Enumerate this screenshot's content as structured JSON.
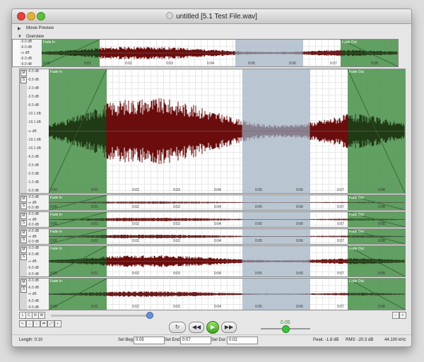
{
  "window": {
    "title": "untitled [5.1 Test File.wav]"
  },
  "sections": {
    "movie_preview": "Movie Preview",
    "overview": "Overview"
  },
  "colors": {
    "fade": "#5a9a5a",
    "wave": "#6b0d0d",
    "wave_sel": "#8a7f8f",
    "selection": "#b9c6d2",
    "wave_fade": "#203a15"
  },
  "fade_labels": {
    "in": "Fade In",
    "out": "Fade Out"
  },
  "time_ticks": [
    "0:00",
    "0:01",
    "0:02",
    "0:03",
    "0:04",
    "0:05",
    "0:06",
    "0:07",
    "0:08"
  ],
  "overview_db": [
    "-0.0 dB",
    "-6.0 dB",
    "-∞ dB",
    "-6.0 dB",
    "-0.0 dB"
  ],
  "main_db": [
    "-0.0 dB",
    "-0.9 dB",
    "-2.0 dB",
    "-3.5 dB",
    "-6.0 dB",
    "-10.1 dB",
    "-19.1 dB",
    "-∞ dB",
    "-19.1 dB",
    "-10.1 dB",
    "-6.0 dB",
    "-3.5 dB",
    "-2.0 dB",
    "-1.2 dB",
    "-0.0 dB"
  ],
  "small_db": [
    "-0.0 dB",
    "-∞ dB",
    "-0.0 dB"
  ],
  "mid_db": [
    "-0.0 dB",
    "-6.0 dB",
    "-∞ dB",
    "-6.0 dB",
    "-0.0 dB"
  ],
  "track_controls": {
    "mute": "M",
    "solo": "S"
  },
  "bottom_buttons": [
    "L",
    "C",
    "R",
    "W"
  ],
  "tool_buttons": [
    "↖",
    "↔",
    "↕",
    "⇄",
    "⤢",
    "◐"
  ],
  "transport": {
    "loop": "↻",
    "rewind": "◀◀",
    "play": "▶",
    "forward": "▶▶"
  },
  "volume": {
    "value": "0.05",
    "level": 0.5
  },
  "status": {
    "length": "Length: 0:10",
    "sel_beg_label": "Sel Beg:",
    "sel_beg": "0:05",
    "sel_end_label": "Sel End:",
    "sel_end": "0:07",
    "sel_dur_label": "Sel Dur:",
    "sel_dur": "0:02",
    "peak": "Peak: -1.8 dB",
    "rms": "RMS: -20.3 dB",
    "rate": "44.100 kHz"
  }
}
